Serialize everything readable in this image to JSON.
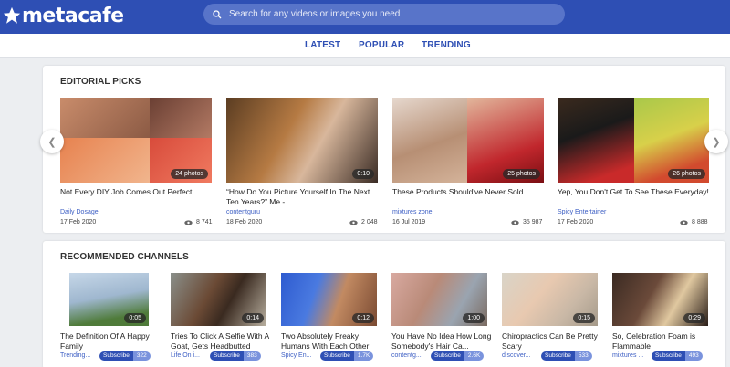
{
  "header": {
    "logo_text": "metacafe",
    "search_placeholder": "Search for any videos or images you need"
  },
  "nav": [
    "LATEST",
    "POPULAR",
    "TRENDING"
  ],
  "editorial": {
    "title": "EDITORIAL PICKS",
    "items": [
      {
        "badge": "24 photos",
        "title": "Not Every DIY Job Comes Out Perfect",
        "source": "Daily Dosage",
        "date": "17 Feb 2020",
        "views": "8 741"
      },
      {
        "badge": "0:10",
        "title": "“How Do You Picture Yourself In The Next Ten Years?” Me -",
        "source": "contentguru",
        "date": "18 Feb 2020",
        "views": "2 048"
      },
      {
        "badge": "25 photos",
        "title": "These Products Should've Never Sold",
        "source": "mixtures zone",
        "date": "16 Jul 2019",
        "views": "35 987"
      },
      {
        "badge": "26 photos",
        "title": "Yep, You Don't Get To See These Everyday!",
        "source": "Spicy Entertainer",
        "date": "17 Feb 2020",
        "views": "8 888"
      }
    ]
  },
  "channels": {
    "title": "RECOMMENDED CHANNELS",
    "subscribe_label": "Subscribe",
    "items": [
      {
        "badge": "0:05",
        "title": "The Definition Of A Happy Family",
        "channel": "Trending...",
        "subs": "322"
      },
      {
        "badge": "0:14",
        "title": "Tries To Click A Selfie With A Goat, Gets Headbutted",
        "channel": "Life On i...",
        "subs": "383"
      },
      {
        "badge": "0:12",
        "title": "Two Absolutely Freaky Humans With Each Other",
        "channel": "Spicy En...",
        "subs": "1.7K"
      },
      {
        "badge": "1:00",
        "title": "You Have No Idea How Long Somebody's Hair Ca...",
        "channel": "contentg...",
        "subs": "2.6K"
      },
      {
        "badge": "0:15",
        "title": "Chiropractics Can Be Pretty Scary",
        "channel": "discover...",
        "subs": "533"
      },
      {
        "badge": "0:29",
        "title": "So, Celebration Foam is Flammable",
        "channel": "mixtures ...",
        "subs": "493"
      }
    ]
  },
  "colors": {
    "brand": "#2e4fb4",
    "link": "#3d5fc4"
  }
}
